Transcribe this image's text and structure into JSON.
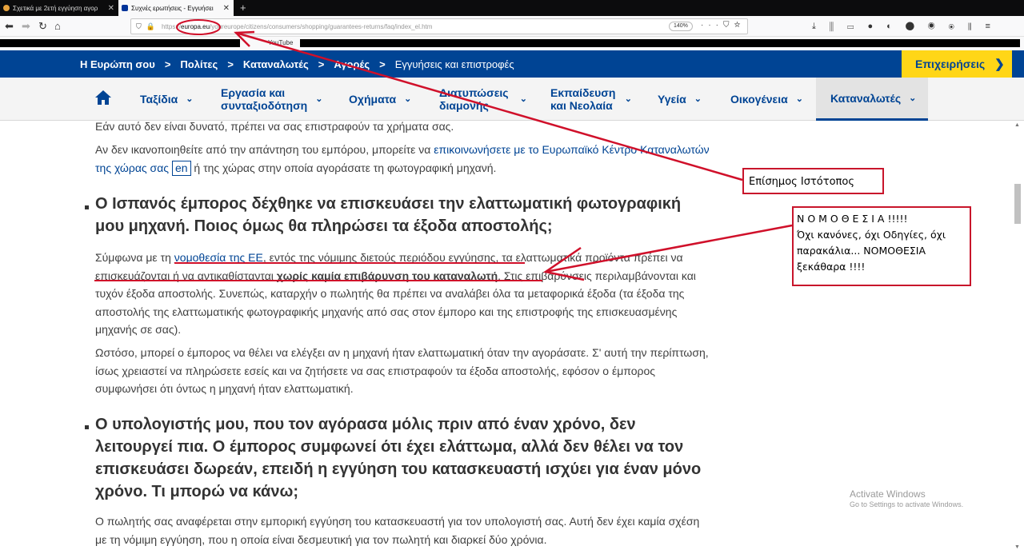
{
  "browser": {
    "tabs": [
      {
        "title": "Σχετικά με 2ετή εγγύηση αγορ"
      },
      {
        "title": "Συχνές ερωτήσεις - Εγγυήσει"
      }
    ],
    "url_domain": "europa.eu",
    "url_rest": "/youreurope/citizens/consumers/shopping/guarantees-returns/faq/index_el.htm",
    "url_prefix": "https://",
    "zoom": "140%",
    "bookmark_text": "YouTube"
  },
  "site": {
    "breadcrumbs": [
      "Η Ευρώπη σου",
      "Πολίτες",
      "Καταναλωτές",
      "Αγορές",
      "Εγγυήσεις και επιστροφές"
    ],
    "business_button": "Επιχειρήσεις",
    "nav": {
      "items": [
        {
          "label": "Ταξίδια"
        },
        {
          "label": "Εργασία και συνταξιοδότηση"
        },
        {
          "label": "Οχήματα"
        },
        {
          "label": "Διατυπώσεις διαμονής"
        },
        {
          "label": "Εκπαίδευση και Νεολαία"
        },
        {
          "label": "Υγεία"
        },
        {
          "label": "Οικογένεια"
        },
        {
          "label": "Καταναλωτές"
        }
      ]
    }
  },
  "content": {
    "p0": "Εάν αυτό δεν είναι δυνατό, πρέπει να σας επιστραφούν τα χρήματα σας.",
    "p1a": "Αν δεν ικανοποιηθείτε από την απάντηση του εμπόρου, μπορείτε να ",
    "p1link": "επικοινωνήσετε με το Ευρωπαϊκό Κέντρο Καταναλωτών της χώρας σας",
    "p1en": "en",
    "p1b": " ή της χώρας στην οποία αγοράσατε τη φωτογραφική μηχανή.",
    "h1": "Ο Ισπανός έμπορος δέχθηκε να επισκευάσει την ελαττωματική φωτογραφική μου μηχανή. Ποιος όμως θα πληρώσει τα έξοδα αποστολής;",
    "p2a": "Σύμφωνα με τη ",
    "p2link": "νομοθεσία της ΕΕ",
    "p2b": ", εντός της νόμιμης διετούς περιόδου εγγύησης, τα ελαττωματικά προϊόντα πρέπει να επισκευάζονται ή να αντικαθίστανται ",
    "p2bold": "χωρίς καμία επιβάρυνση του καταναλωτή",
    "p2c": ". Στις επιβαρύνσεις περιλαμβάνονται και τυχόν έξοδα αποστολής. Συνεπώς, καταρχήν ο πωλητής θα πρέπει να αναλάβει όλα τα μεταφορικά έξοδα (τα έξοδα της αποστολής της ελαττωματικής φωτογραφικής μηχανής από σας στον έμπορο και της επιστροφής της επισκευασμένης μηχανής σε σας).",
    "p3": "Ωστόσο, μπορεί ο έμπορος να θέλει να ελέγξει αν η μηχανή ήταν ελαττωματική όταν την αγοράσατε. Σ' αυτή την περίπτωση, ίσως χρειαστεί να πληρώσετε εσείς και να ζητήσετε να σας επιστραφούν τα έξοδα αποστολής, εφόσον ο έμπορος συμφωνήσει ότι όντως η μηχανή ήταν ελαττωματική.",
    "h2": "Ο υπολογιστής μου, που τον αγόρασα μόλις πριν από έναν χρόνο, δεν λειτουργεί πια. Ο έμπορος συμφωνεί ότι έχει ελάττωμα, αλλά δεν θέλει να τον επισκευάσει δωρεάν, επειδή η εγγύηση του κατασκευαστή ισχύει για έναν μόνο χρόνο. Τι μπορώ να κάνω;",
    "p4": "Ο πωλητής σας αναφέρεται στην εμπορική εγγύηση του κατασκευαστή για τον υπολογιστή σας. Αυτή δεν έχει καμία σχέση με τη νόμιμη εγγύηση, που η οποία είναι δεσμευτική για τον πωλητή και διαρκεί δύο χρόνια."
  },
  "annotations": {
    "callout_official": "Επίσημος Ιστότοπος",
    "callout_law": "Ν Ο Μ Ο Θ Ε Σ Ι Α !!!!!\nΌχι κανόνες, όχι Οδηγίες, όχι παρακάλια... ΝΟΜΟΘΕΣΙΑ ξεκάθαρα !!!!",
    "color": "#d0102a"
  },
  "watermark": {
    "line1": "Activate Windows",
    "line2": "Go to Settings to activate Windows."
  }
}
